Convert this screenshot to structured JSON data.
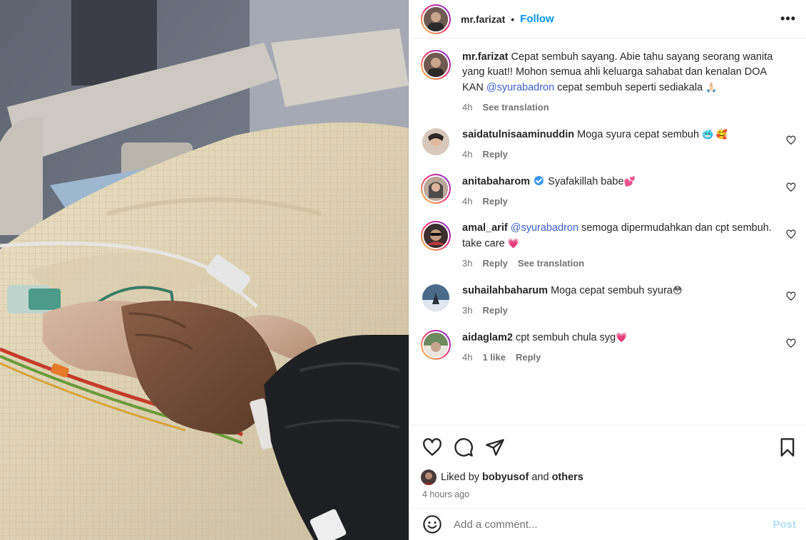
{
  "header": {
    "username": "mr.farizat",
    "separator": "•",
    "follow_label": "Follow",
    "more_label": "•••"
  },
  "caption": {
    "username": "mr.farizat",
    "text": "Cepat sembuh sayang. Abie tahu sayang seorang wanita yang kuat!! Mohon semua ahli keluarga sahabat dan kenalan DOA KAN",
    "mention": "@syurabadron",
    "text_after": "cepat sembuh seperti sediakala",
    "emoji": "🙏🏻",
    "time": "4h",
    "translate_label": "See translation"
  },
  "comments": [
    {
      "username": "saidatulnisaaminuddin",
      "text": "Moga syura cepat sembuh",
      "emoji": "🥶 🥰",
      "time": "4h",
      "reply_label": "Reply",
      "verified": false
    },
    {
      "username": "anitabaharom",
      "text": "Syafakillah babe",
      "emoji": "💕",
      "time": "4h",
      "reply_label": "Reply",
      "verified": true
    },
    {
      "username": "amal_arif",
      "mention": "@syurabadron",
      "text": "semoga dipermudahkan dan cpt sembuh. take care",
      "emoji": "💗",
      "time": "3h",
      "reply_label": "Reply",
      "translate_label": "See translation",
      "verified": false
    },
    {
      "username": "suhailahbaharum",
      "text": "Moga cepat sembuh syura",
      "emoji": "😳",
      "time": "3h",
      "reply_label": "Reply",
      "verified": false
    },
    {
      "username": "aidaglam2",
      "text": "cpt sembuh chula syg",
      "emoji": "💗",
      "time": "4h",
      "likes_label": "1 like",
      "reply_label": "Reply",
      "verified": false
    }
  ],
  "likes": {
    "prefix": "Liked by",
    "user": "bobyusof",
    "and": "and",
    "others": "others",
    "time_ago": "4 hours ago"
  },
  "add_comment": {
    "placeholder": "Add a comment...",
    "post_label": "Post"
  },
  "colors": {
    "accent": "#0095f6",
    "mention": "#3a5fcd",
    "muted": "#737373",
    "post_disabled": "#b2dffc"
  },
  "icons": [
    "heart-icon",
    "comment-icon",
    "share-icon",
    "bookmark-icon",
    "emoji-icon",
    "more-icon",
    "verified-icon"
  ]
}
